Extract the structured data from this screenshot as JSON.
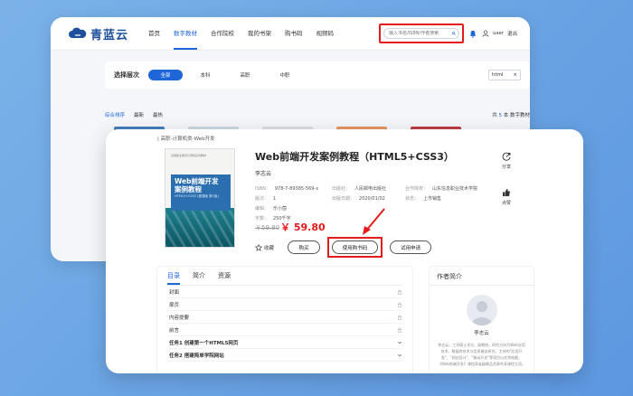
{
  "brand": {
    "name": "青蓝云"
  },
  "nav": {
    "items": [
      "首页",
      "数字教材",
      "合作院校",
      "我的书架",
      "购书码",
      "视频码"
    ],
    "active_index": 1
  },
  "search": {
    "placeholder": "输入书名/ISBN/作者搜索"
  },
  "user": {
    "name": "user",
    "logout": "退出"
  },
  "level_filter": {
    "title": "选择层次",
    "tabs": [
      "全部",
      "本科",
      "高职",
      "中职"
    ],
    "active_index": 0,
    "tag": "html"
  },
  "sort": {
    "options": [
      "综合排序",
      "最新",
      "最热"
    ],
    "active_index": 0,
    "total_prefix": "共",
    "total_count": "5",
    "total_suffix": "本 数字教材"
  },
  "book": {
    "breadcrumb": "| 高职-计算机类-Web开发",
    "title": "Web前端开发案例教程（HTML5+CSS3）",
    "author": "李志云",
    "meta": {
      "isbn_label": "ISBN：",
      "isbn": "978-7-89385-569-x",
      "publisher_label": "出版社：",
      "publisher": "人民邮电出版社",
      "school_label": "合作院校：",
      "school": "山东信息职业技术学院",
      "edition_label": "版次：",
      "edition": "1",
      "pubdate_label": "出版日期：",
      "pubdate": "2020/01/02",
      "status_label": "状态：",
      "status": "上市销售",
      "editor_label": "编辑：",
      "editor": "乐小茵",
      "words_label": "字数：",
      "words": "250千字"
    },
    "price_old": "￥59.80",
    "price_new": "￥ 59.80",
    "cover": {
      "top_text": "高等职业教育计算机系列教材",
      "title_line1": "Web前端开发",
      "title_line2": "案例教程",
      "sub": "HTML5+CSS3 (微课版 第2版)"
    }
  },
  "actions": {
    "favorite": "收藏",
    "buy": "购买",
    "use_code": "使用购书码",
    "trial": "试用申请"
  },
  "side_tools": {
    "share": "分享",
    "like": "点赞"
  },
  "toc": {
    "tabs": [
      "目录",
      "简介",
      "资源"
    ],
    "active_index": 0,
    "rows": [
      {
        "label": "封面",
        "bold": false
      },
      {
        "label": "扉页",
        "bold": false
      },
      {
        "label": "内容提要",
        "bold": false
      },
      {
        "label": "前言",
        "bold": false
      },
      {
        "label": "任务1 创建第一个HTML5网页",
        "bold": true
      },
      {
        "label": "任务2 搭建简单学院网站",
        "bold": true
      }
    ]
  },
  "author_panel": {
    "title": "作者简介",
    "name": "李志云",
    "bio": "李志云，工学硕士学位，副教授，研究方向为Web应用技术、数据库技术与信息服务研究，主持的\"应用开发\"、\"网站设计\"、\"移动开发\"等项目以优秀结题，《Web前端开发》课程获省级精品资源共享课程立项。"
  },
  "colors": {
    "accent": "#1f66d9",
    "highlight": "#e31b1b",
    "background": "#6aa5e4"
  }
}
